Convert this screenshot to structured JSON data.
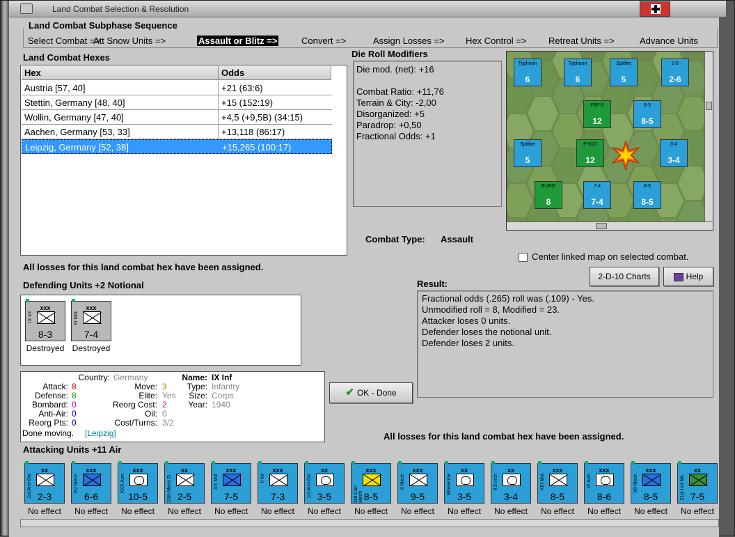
{
  "window": {
    "title": "Land Combat Selection & Resolution"
  },
  "subphase": {
    "title": "Land Combat Subphase Sequence",
    "steps": [
      "Select Combat =>",
      "Att Snow Units =>",
      "Assault or Blitz =>",
      "Convert =>",
      "Assign Losses =>",
      "Hex Control =>",
      "Retreat Units =>",
      "Advance Units"
    ],
    "active_index": 2
  },
  "hexes": {
    "title": "Land Combat Hexes",
    "headers": [
      "Hex",
      "Odds"
    ],
    "rows": [
      {
        "hex": "Austria [57, 40]",
        "odds": "+21 (63:6)"
      },
      {
        "hex": "Stettin, Germany [48, 40]",
        "odds": "+15 (152:19)"
      },
      {
        "hex": "Wollin, Germany [47, 40]",
        "odds": "+4,5 (+9,5B) (34:15)"
      },
      {
        "hex": "Aachen, Germany [53, 33]",
        "odds": "+13,118 (86:17)"
      },
      {
        "hex": "Leipzig, Germany [52, 38]",
        "odds": "+15,265 (100:17)"
      }
    ],
    "selected_index": 4
  },
  "die_roll": {
    "title": "Die Roll Modifiers",
    "lines": [
      "Die mod. (net): +16",
      "",
      "Combat Ratio: +11,76",
      "Terrain & City: -2,00",
      "Disorganized: +5",
      "Paradrop: +0,50",
      "Fractional Odds: +1"
    ]
  },
  "combat_type": {
    "label": "Combat Type:",
    "value": "Assault"
  },
  "map": {
    "center_label": "Center linked map on selected combat.",
    "center_checked": false
  },
  "buttons": {
    "charts": "2-D-10 Charts",
    "help": "Help",
    "ok": "OK - Done"
  },
  "losses_message": "All losses for this land combat hex have been assigned.",
  "defending": {
    "title": "Defending Units +2 Notional",
    "units": [
      {
        "size": "xxx",
        "side": "IX Inf",
        "value": "8-3",
        "status": "Destroyed",
        "symbol": "x"
      },
      {
        "size": "xxx",
        "side": "XI Mot",
        "value": "7-4",
        "status": "Destroyed",
        "symbol": "x"
      }
    ]
  },
  "unit_details": {
    "country_label": "Country:",
    "country": "Germany",
    "attack_label": "Attack:",
    "attack": "8",
    "defense_label": "Defense:",
    "defense": "8",
    "bombard_label": "Bombard:",
    "bombard": "0",
    "antiair_label": "Anti-Air:",
    "antiair": "0",
    "reorg_pts_label": "Reorg Pts:",
    "reorg_pts": "0",
    "done_label": "Done moving.",
    "done_place": "[Leipzig]",
    "move_label": "Move:",
    "move": "3",
    "elite_label": "Elite:",
    "elite": "Yes",
    "reorg_cost_label": "Reorg Cost:",
    "reorg_cost": "2",
    "oil_label": "Oil:",
    "oil": "0",
    "cost_turns_label": "Cost/Turns:",
    "cost_turns": "3/2",
    "name_label": "Name:",
    "name": "IX Inf",
    "type_label": "Type:",
    "type": "Infantry",
    "size_label": "Size:",
    "size": "Corps",
    "year_label": "Year:",
    "year": "1940"
  },
  "result": {
    "title": "Result:",
    "lines": [
      "Fractional odds (.265) roll was (.109)  - Yes.",
      "Unmodified roll = 8, Modified = 23.",
      "Attacker loses 0 units.",
      "Defender loses the notional unit.",
      "Defender loses 2 units."
    ]
  },
  "attacking": {
    "title": "Attacking Units +11 Air",
    "units": [
      {
        "size": "xx",
        "side": "1st Arm Div",
        "value": "2-3",
        "status": "No effect",
        "symbol": "x"
      },
      {
        "size": "xxx",
        "side": "XV Mech",
        "value": "6-6",
        "status": "No effect",
        "symbol": "bluefill"
      },
      {
        "size": "xxx",
        "side": "XXX Arm",
        "value": "10-5",
        "status": "No effect",
        "symbol": "oval"
      },
      {
        "size": "xx",
        "side": "10th Mech D.",
        "value": "2-5",
        "status": "No effect",
        "symbol": "x"
      },
      {
        "size": "xxx",
        "side": "XX Mot",
        "value": "7-5",
        "status": "No effect",
        "symbol": "bluefill"
      },
      {
        "size": "xxx",
        "side": "II Inf",
        "value": "7-3",
        "status": "No effect",
        "symbol": "x"
      },
      {
        "size": "xx",
        "side": "1st Arm Div",
        "value": "3-5",
        "status": "No effect",
        "symbol": "oval"
      },
      {
        "size": "xxx",
        "side": "3rd Can Mech",
        "value": "8-5",
        "status": "No effect",
        "symbol": "yellowfill"
      },
      {
        "size": "xxx",
        "side": "X Mech",
        "value": "9-5",
        "status": "No effect",
        "symbol": "x"
      },
      {
        "size": "xx",
        "side": "Wolverine",
        "value": "3-5",
        "status": "No effect",
        "symbol": "oval"
      },
      {
        "size": "xx",
        "side": "4.5 inch",
        "value": "3-4",
        "status": "No effect",
        "symbol": "oval"
      },
      {
        "size": "xxx",
        "side": "XIII Mot",
        "value": "8-5",
        "status": "No effect",
        "symbol": "x"
      },
      {
        "size": "xxx",
        "side": "IX Arm",
        "value": "8-6",
        "status": "No effect",
        "symbol": "oval"
      },
      {
        "size": "xxx",
        "side": "XII Mech",
        "value": "8-5",
        "status": "No effect",
        "symbol": "bluefill"
      },
      {
        "size": "xx",
        "side": "21st Ind Me.",
        "value": "7-5",
        "status": "No effect",
        "symbol": "greenfill"
      }
    ]
  },
  "map_counters": [
    {
      "label": "Typhoon",
      "value": "6",
      "color": "blue"
    },
    {
      "label": "Typhoon",
      "value": "6",
      "color": "blue"
    },
    {
      "label": "Spitfire",
      "value": "5",
      "color": "blue"
    },
    {
      "label": "2-6",
      "value": "2-6",
      "color": "blue"
    },
    {
      "label": "F6F-3",
      "value": "12",
      "color": "green"
    },
    {
      "label": "8-5",
      "value": "8-5",
      "color": "blue"
    },
    {
      "label": "P-51D",
      "value": "12",
      "color": "green"
    },
    {
      "label": "3-4",
      "value": "3-4",
      "color": "blue"
    },
    {
      "label": "7-4",
      "value": "7-4",
      "color": "blue"
    },
    {
      "label": "8-5",
      "value": "8-5",
      "color": "blue"
    },
    {
      "label": "Spitfire",
      "value": "5",
      "color": "blue"
    },
    {
      "label": "B-25G",
      "value": "8",
      "color": "green"
    }
  ]
}
